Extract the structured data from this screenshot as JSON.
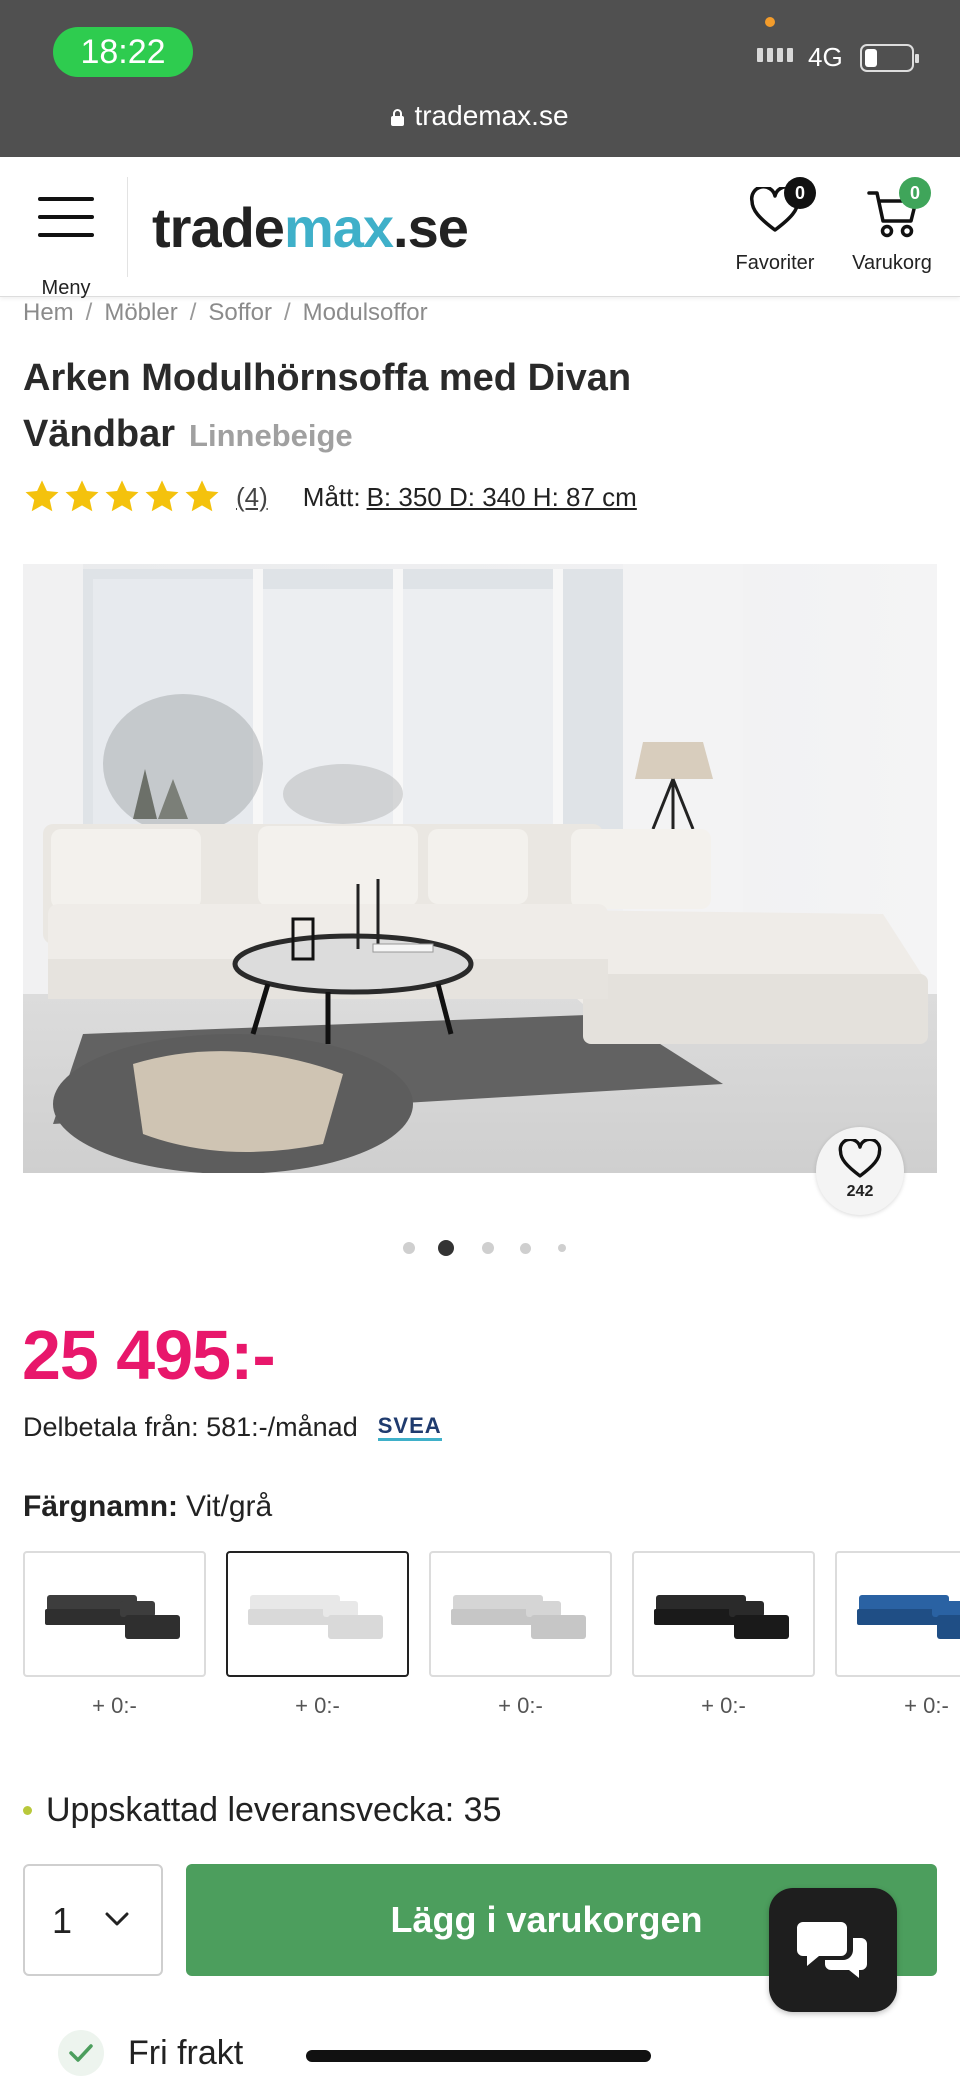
{
  "status_bar": {
    "time": "18:22",
    "network": "4G",
    "url": "trademax.se"
  },
  "header": {
    "menu_label": "Meny",
    "logo_part1": "trade",
    "logo_part2": "max",
    "logo_part3": ".se",
    "favorites_label": "Favoriter",
    "favorites_count": "0",
    "cart_label": "Varukorg",
    "cart_count": "0",
    "brand_color": "#3fb0c9"
  },
  "breadcrumb": [
    {
      "label": "Hem"
    },
    {
      "label": "Möbler"
    },
    {
      "label": "Soffor"
    },
    {
      "label": "Modulsoffor"
    }
  ],
  "product": {
    "title": "Arken Modulhörnsoffa med Divan Vändbar",
    "variant": "Linnebeige",
    "rating_stars": 5,
    "review_count": "(4)",
    "dims_label": "Mått:",
    "dims_value": "B: 350 D: 340 H: 87 cm",
    "favorite_count": "242",
    "image_count": 5,
    "active_image_index": 1,
    "price": "25 495:-",
    "price_color": "#e8176b",
    "installment_text": "Delbetala från: 581:-/månad",
    "installment_provider": "SVEA"
  },
  "color": {
    "label": "Färgnamn:",
    "value": "Vit/grå",
    "options": [
      {
        "name": "dark-grey",
        "price": "+ 0:-"
      },
      {
        "name": "white-grey",
        "price": "+ 0:-",
        "selected": true
      },
      {
        "name": "light-grey",
        "price": "+ 0:-"
      },
      {
        "name": "black",
        "price": "+ 0:-"
      },
      {
        "name": "blue",
        "price": "+ 0:-"
      }
    ]
  },
  "delivery": {
    "text": "Uppskattad leveransvecka: 35"
  },
  "purchase": {
    "quantity": "1",
    "add_to_cart_label": "Lägg i varukorgen",
    "button_color": "#4c9e5d"
  },
  "shipping": {
    "free_shipping_label": "Fri frakt"
  },
  "icons": [
    "lock-icon",
    "hamburger-icon",
    "heart-icon",
    "cart-icon",
    "star-icon",
    "chevron-down-icon",
    "chat-icon",
    "check-icon"
  ]
}
